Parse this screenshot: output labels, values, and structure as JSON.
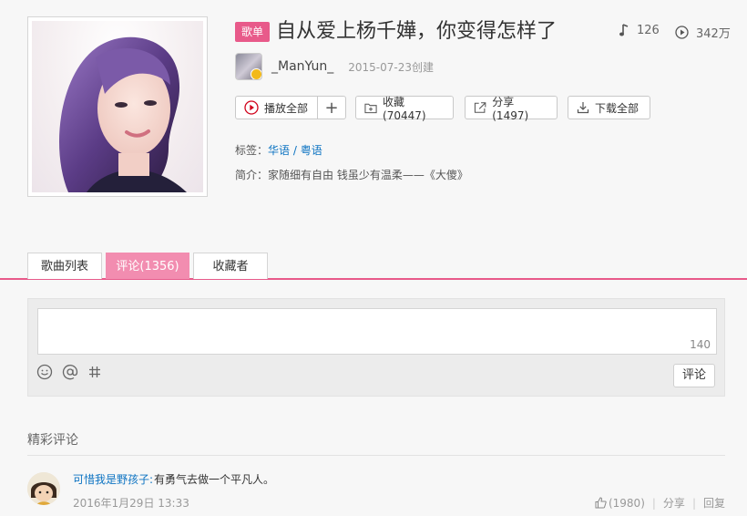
{
  "playlist": {
    "badge": "歌单",
    "title": "自从爱上杨千嬅，你变得怎样了",
    "track_count": "126",
    "play_count": "342万",
    "creator": "_ManYun_",
    "created": "2015-07-23创建",
    "tags_label": "标签：",
    "tags": [
      "华语",
      "粤语"
    ],
    "tag_sep": " / ",
    "desc_label": "简介：",
    "description": "家随细有自由 钱虽少有温柔——《大傻》"
  },
  "actions": {
    "play_all": "播放全部",
    "add": "+",
    "collect": "收藏(70447)",
    "share": "分享(1497)",
    "download_all": "下载全部"
  },
  "tabs": [
    {
      "label": "歌曲列表"
    },
    {
      "label": "评论(1356)"
    },
    {
      "label": "收藏者"
    }
  ],
  "comment_editor": {
    "counter": "140",
    "submit": "评论",
    "tools": [
      "emoji-icon",
      "at-icon",
      "hash-icon"
    ]
  },
  "hot_comments": {
    "title": "精彩评论",
    "items": [
      {
        "user": "可惜我是野孩子:",
        "text": "有勇气去做一个平凡人。",
        "time": "2016年1月29日 13:33",
        "likes": "(1980)",
        "share": "分享",
        "reply": "回复"
      }
    ]
  },
  "colors": {
    "accent": "#e85a8a",
    "tab_active": "#f28db0",
    "link": "#0c73c2",
    "play_red": "#d0021b"
  }
}
